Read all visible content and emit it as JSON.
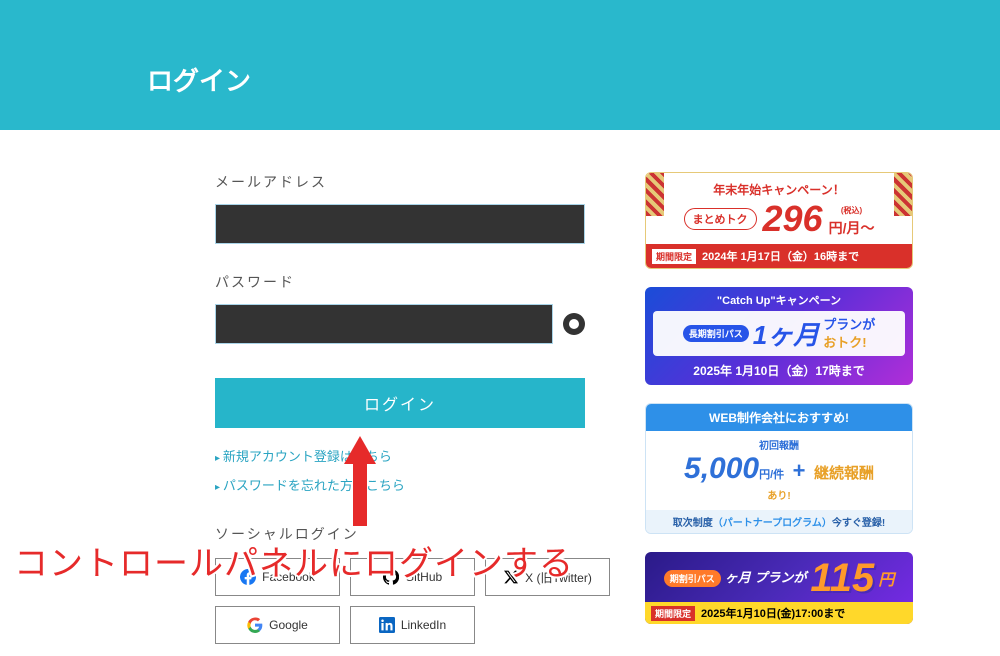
{
  "header": {
    "title": "ログイン"
  },
  "form": {
    "email_label": "メールアドレス",
    "password_label": "パスワード",
    "login_button": "ログイン"
  },
  "links": {
    "register": "新規アカウント登録はこちら",
    "forgot": "パスワードを忘れた方はこちら"
  },
  "social": {
    "title": "ソーシャルログイン",
    "facebook": "Facebook",
    "github": "GitHub",
    "x": "X (旧Twitter)",
    "google": "Google",
    "linkedin": "LinkedIn"
  },
  "banners": {
    "b1": {
      "campaign": "年末年始キャンペーン！",
      "badge": "まとめトク",
      "price": "296",
      "unit": "円/月〜",
      "tax": "(税込)",
      "limited": "期間限定",
      "deadline": "2024年 1月17日（金）16時まで"
    },
    "b2": {
      "campaign": "\"Catch Up\"キャンペーン",
      "badge": "長期割引パス",
      "big": "1ヶ月",
      "plan": "プランが",
      "otoku": "おトク!",
      "deadline": "2025年 1月10日（金）17時まで"
    },
    "b3": {
      "top": "WEB制作会社におすすめ!",
      "init": "初回報酬",
      "price": "5,000",
      "unit": "円/件",
      "plus": "+",
      "keizoku": "継続報酬",
      "ari": "あり!",
      "bottom_pre": "取次制度",
      "partner": "（パートナープログラム）",
      "bottom_post": "今すぐ登録!"
    },
    "b4": {
      "badge": "期割引パス",
      "month": "ヶ月\nプランが",
      "price": "115",
      "yen": "円",
      "limited": "期間限定",
      "deadline": "2025年1月10日(金)17:00まで"
    }
  },
  "annotation": {
    "text": "コントロールパネルにログインする"
  }
}
